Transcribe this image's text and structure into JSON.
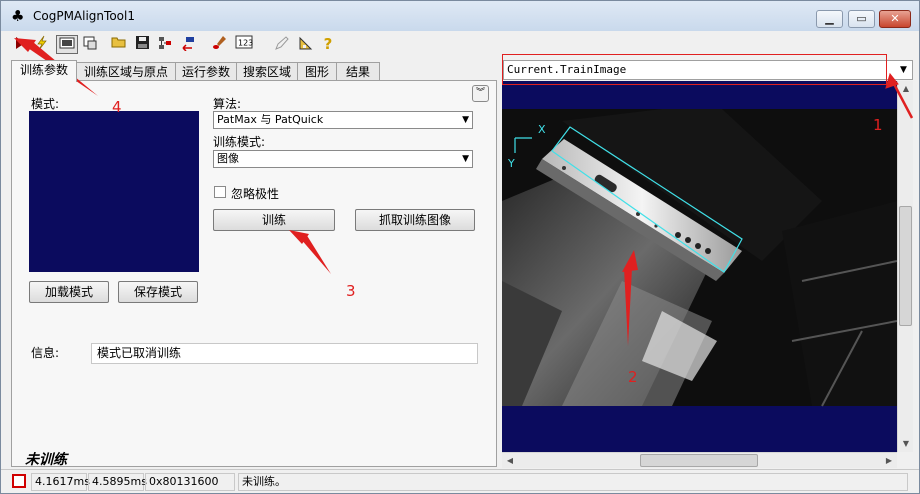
{
  "window": {
    "title": "CogPMAlignTool1",
    "minimize": "▁",
    "maximize": "▭",
    "close": "✕"
  },
  "tabs": [
    "训练参数",
    "训练区域与原点",
    "运行参数",
    "搜索区域",
    "图形",
    "结果"
  ],
  "train_panel": {
    "model_label": "模式:",
    "algorithm_label": "算法:",
    "algorithm_value": "PatMax 与 PatQuick",
    "train_mode_label": "训练模式:",
    "train_mode_value": "图像",
    "ignore_polarity_label": "忽略极性",
    "train_button": "训练",
    "grab_train_image_button": "抓取训练图像",
    "load_model_button": "加载模式",
    "save_model_button": "保存模式",
    "info_label": "信息:",
    "info_value": "模式已取消训练",
    "train_status": "未训练"
  },
  "image_selector": {
    "value": "Current.TrainImage"
  },
  "viewer": {
    "axis_x": "X",
    "axis_y": "Y"
  },
  "statusbar": {
    "time1": "4.1617ms",
    "time2": "4.5895ms",
    "code": "0x80131600",
    "message": "未训练。"
  },
  "annotations": [
    "1",
    "2",
    "3",
    "4"
  ],
  "colors": {
    "viewer_bg": "#0b0b5e",
    "annotation": "#e02020",
    "region": "#40e0e8"
  }
}
